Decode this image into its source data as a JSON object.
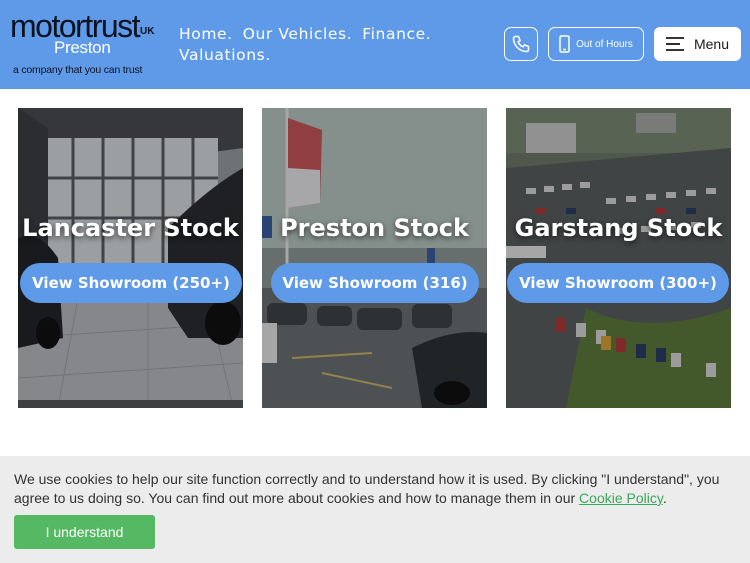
{
  "logo": {
    "brand": "motortrust",
    "brand_suffix": "UK",
    "location": "Preston",
    "tagline": "a company that you can trust"
  },
  "nav": {
    "items": [
      {
        "label": "Home."
      },
      {
        "label": "Our Vehicles."
      },
      {
        "label": "Finance."
      },
      {
        "label": "Valuations."
      }
    ]
  },
  "header_actions": {
    "phone_icon": "phone-icon",
    "out_of_hours_label": "Out of Hours",
    "out_of_hours_icon": "mobile-phone-icon",
    "menu_label": "Menu",
    "menu_icon": "hamburger-icon"
  },
  "stock_cards": [
    {
      "title": "Lancaster Stock",
      "button_label": "View Showroom (250+)"
    },
    {
      "title": "Preston Stock",
      "button_label": "View Showroom (316)"
    },
    {
      "title": "Garstang Stock",
      "button_label": "View Showroom (300+)"
    }
  ],
  "cookie_banner": {
    "text_before_link": "We use cookies to help our site function correctly and to understand how it is used. By clicking \"I understand\", you agree to us doing so. You can find out more about cookies and how to manage them in our ",
    "link_label": "Cookie Policy",
    "text_after_link": ".",
    "accept_label": "I understand"
  },
  "colors": {
    "header_bg": "#5f9ae8",
    "button_blue": "#5f9ae8",
    "cookie_bg": "#ececec",
    "cookie_button": "#55b863",
    "cookie_link": "#3aa85a"
  }
}
